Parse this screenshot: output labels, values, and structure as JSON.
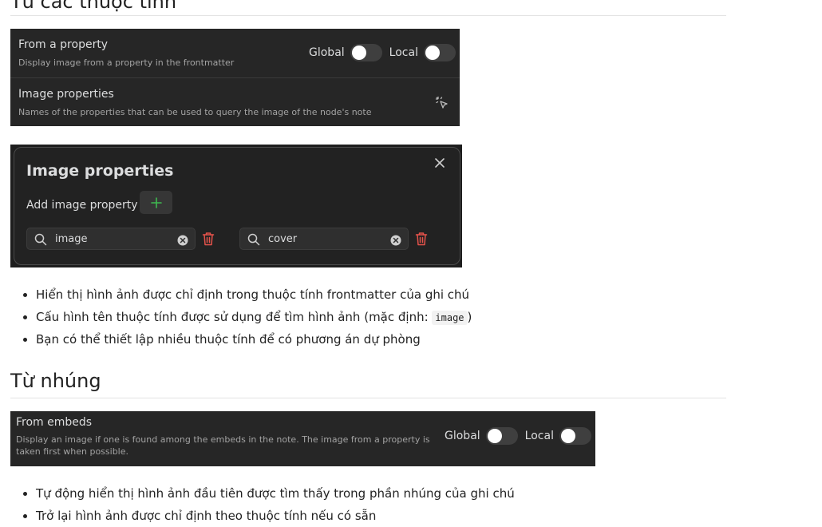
{
  "section1": {
    "heading": "Từ các thuộc tính",
    "panel": {
      "from_property": {
        "name": "From a property",
        "desc": "Display image from a property in the frontmatter",
        "global_label": "Global",
        "local_label": "Local",
        "global_on": false,
        "local_on": false
      },
      "image_properties": {
        "name": "Image properties",
        "desc": "Names of the properties that can be used to query the image of the node's note",
        "icon": "cursor-click-icon"
      }
    },
    "modal": {
      "title": "Image properties",
      "add_label": "Add image property",
      "properties": [
        "image",
        "cover"
      ]
    },
    "bullets": {
      "b1": "Hiển thị hình ảnh được chỉ định trong thuộc tính frontmatter của ghi chú",
      "b2_before": "Cấu hình tên thuộc tính được sử dụng để tìm hình ảnh (mặc định: ",
      "b2_code": "image",
      "b2_after": ")",
      "b3": "Bạn có thể thiết lập nhiều thuộc tính để có phương án dự phòng"
    }
  },
  "section2": {
    "heading": "Từ nhúng",
    "panel": {
      "name": "From embeds",
      "desc_line1": "Display an image if one is found among the embeds in the note. The image from a property is",
      "desc_line2": "taken first when possible.",
      "global_label": "Global",
      "local_label": "Local",
      "global_on": false,
      "local_on": false
    },
    "bullets": {
      "b1": "Tự động hiển thị hình ảnh đầu tiên được tìm thấy trong phần nhúng của ghi chú",
      "b2": "Trở lại hình ảnh được chỉ định theo thuộc tính nếu có sẵn"
    }
  },
  "colors": {
    "accent_green": "#3fb950",
    "danger_red": "#e5534b",
    "panel_bg": "#262626"
  }
}
